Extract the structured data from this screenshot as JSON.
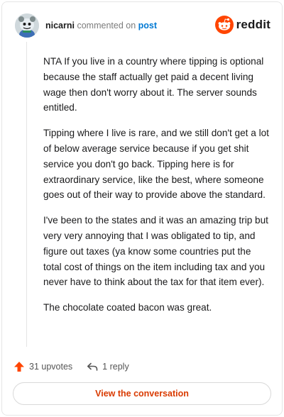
{
  "header": {
    "username": "nicarni",
    "verb": "commented on",
    "post_link": "post",
    "brand": "reddit"
  },
  "comment": {
    "paragraphs": [
      "NTA If you live in a country where tipping is optional because the staff actually get paid a decent living wage then don't worry about it. The server sounds entitled.",
      "Tipping where I live is rare, and we still don't get a lot of below average service because if you get shit service you don't go back. Tipping here is for extraordinary service, like the best, where someone goes out of their way to provide above the standard.",
      "I've been to the states and it was an amazing trip but very very annoying that I was obligated to tip, and figure out taxes (ya know some countries put the total cost of things on the item including tax and you never have to think about the tax for that item ever).",
      "The chocolate coated bacon was great."
    ]
  },
  "actions": {
    "upvotes_label": "31 upvotes",
    "reply_label": "1 reply"
  },
  "footer": {
    "view_button": "View the conversation"
  },
  "colors": {
    "brand_orange": "#ff4500",
    "link_blue": "#0079d3",
    "button_text": "#d93a00"
  },
  "icons": {
    "avatar": "snoo-avatar",
    "brand": "reddit-logo-icon",
    "upvote": "upvote-arrow-icon",
    "reply": "reply-arrow-icon"
  }
}
